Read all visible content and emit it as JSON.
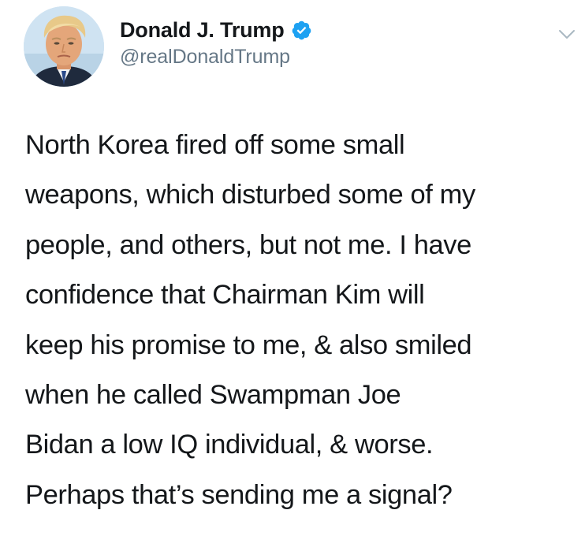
{
  "tweet": {
    "author": {
      "display_name": "Donald J. Trump",
      "handle": "@realDonaldTrump",
      "verified": true,
      "avatar_icon": "profile-photo"
    },
    "menu_icon": "chevron-down-icon",
    "text_lines": [
      "North Korea fired off some small",
      "weapons, which disturbed some of my",
      "people, and others, but not me. I have",
      "confidence that Chairman Kim will",
      "keep his promise to me, & also smiled",
      "when he called Swampman Joe",
      "Bidan a low IQ individual, & worse.",
      "Perhaps that’s sending me a signal?"
    ]
  },
  "colors": {
    "text": "#14171a",
    "secondary_text": "#657786",
    "verified_badge": "#1da1f2",
    "chevron": "#aab8c2",
    "background": "#ffffff"
  }
}
